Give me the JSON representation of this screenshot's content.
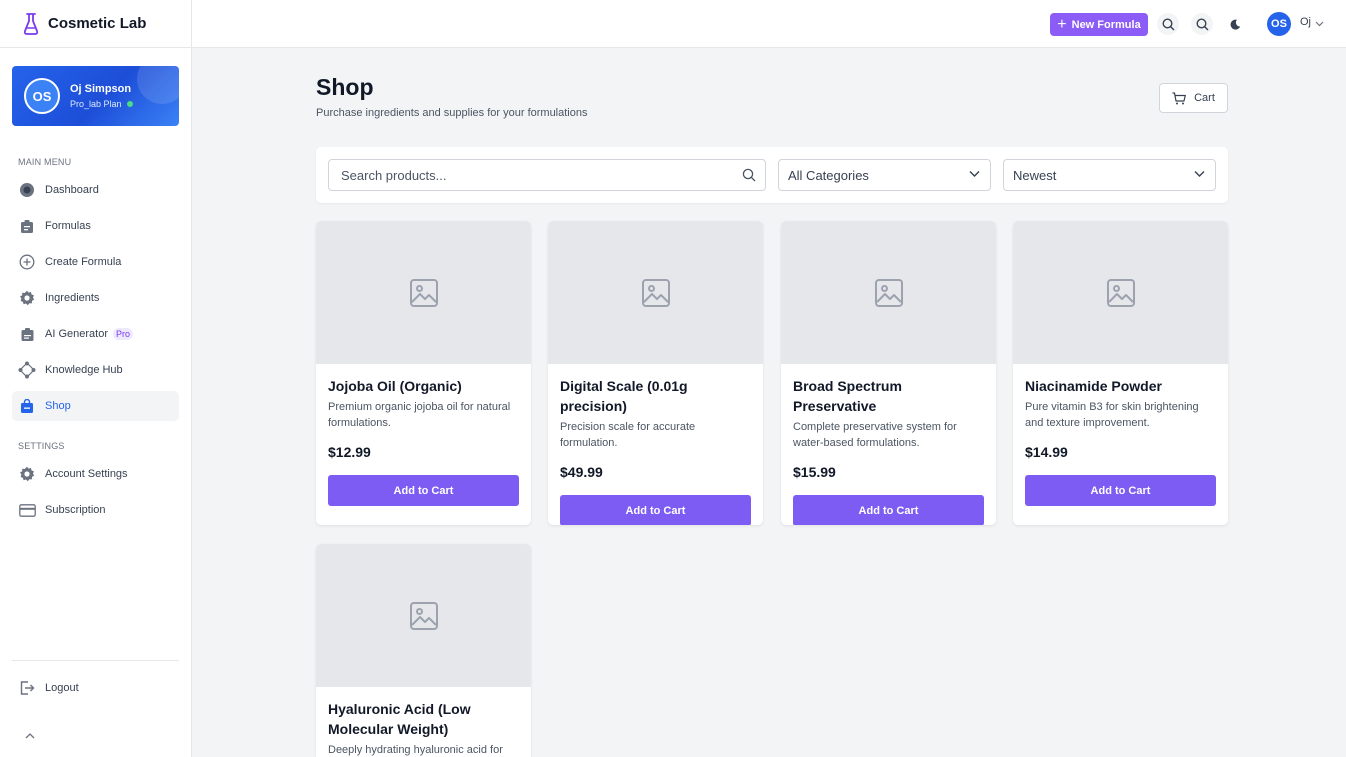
{
  "brand": {
    "name": "Cosmetic Lab"
  },
  "profile": {
    "initials": "OS",
    "name": "Oj Simpson",
    "plan": "Pro_lab Plan"
  },
  "sidebar": {
    "main_menu_label": "MAIN MENU",
    "items": [
      {
        "label": "Dashboard",
        "icon": "dashboard-icon"
      },
      {
        "label": "Formulas",
        "icon": "clipboard-icon"
      },
      {
        "label": "Create Formula",
        "icon": "plus-circle-icon"
      },
      {
        "label": "Ingredients",
        "icon": "gear-icon"
      },
      {
        "label": "AI Generator",
        "icon": "robot-icon",
        "badge": "Pro"
      },
      {
        "label": "Knowledge Hub",
        "icon": "network-icon"
      },
      {
        "label": "Shop",
        "icon": "shop-icon",
        "active": true
      }
    ],
    "settings_label": "SETTINGS",
    "settings_items": [
      {
        "label": "Account Settings",
        "icon": "gear-icon"
      },
      {
        "label": "Subscription",
        "icon": "credit-card-icon"
      }
    ],
    "logout_label": "Logout"
  },
  "topbar": {
    "new_formula_label": "New Formula",
    "user_initials": "OS",
    "user_name": "Oj"
  },
  "page": {
    "title": "Shop",
    "subtitle": "Purchase ingredients and supplies for your formulations",
    "cart_label": "Cart"
  },
  "filters": {
    "search_placeholder": "Search products...",
    "category_value": "All Categories",
    "sort_value": "Newest"
  },
  "products": [
    {
      "name": "Jojoba Oil (Organic)",
      "description": "Premium organic jojoba oil for natural formulations.",
      "price": "$12.99",
      "button": "Add to Cart"
    },
    {
      "name": "Digital Scale (0.01g precision)",
      "description": "Precision scale for accurate formulation.",
      "price": "$49.99",
      "button": "Add to Cart"
    },
    {
      "name": "Broad Spectrum Preservative",
      "description": "Complete preservative system for water-based formulations.",
      "price": "$15.99",
      "button": "Add to Cart"
    },
    {
      "name": "Niacinamide Powder",
      "description": "Pure vitamin B3 for skin brightening and texture improvement.",
      "price": "$14.99",
      "button": "Add to Cart"
    },
    {
      "name": "Hyaluronic Acid (Low Molecular Weight)",
      "description": "Deeply hydrating hyaluronic acid for",
      "price": "",
      "button": ""
    }
  ],
  "colors": {
    "accent": "#8b5cf6",
    "primary": "#2563eb",
    "button": "#7c5cf2"
  }
}
